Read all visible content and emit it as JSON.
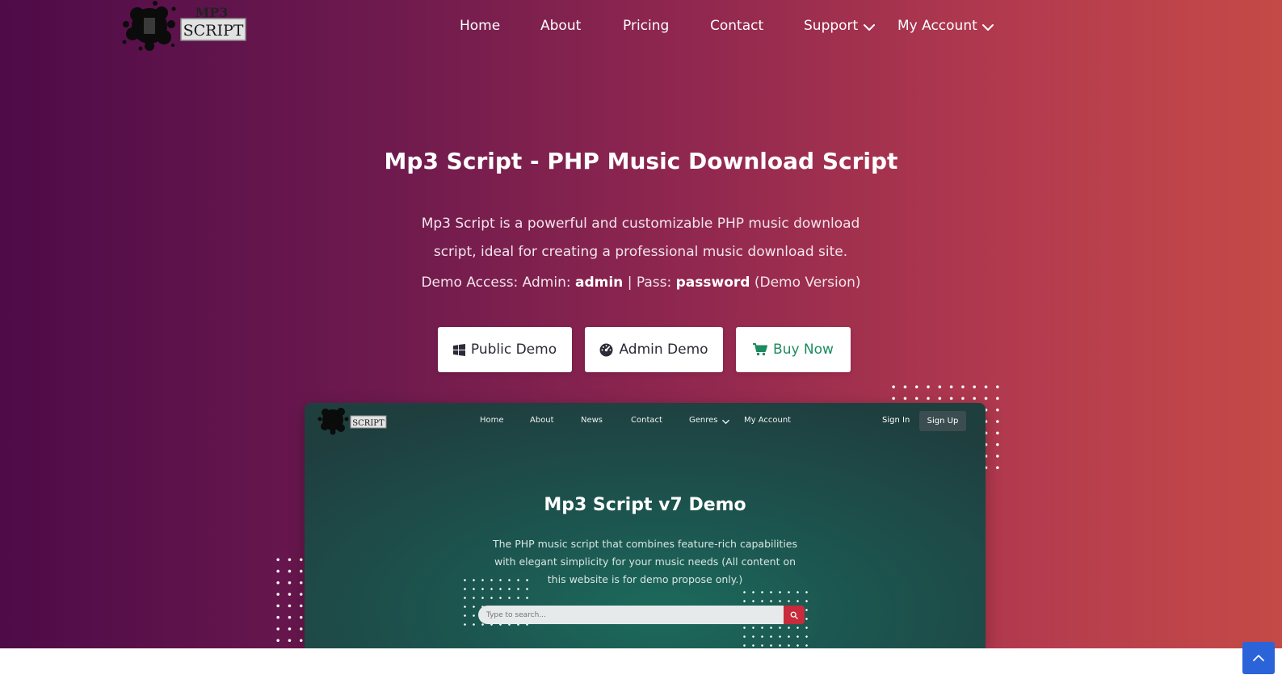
{
  "colors": {
    "hero_gradient_start": "#4e0b48",
    "hero_gradient_end": "#c44a47",
    "buy_button_text": "#1d8a5f",
    "preview_bg": "#1c5650",
    "preview_search_button": "#c72b3c",
    "back_to_top": "#2b64d8"
  },
  "logo": {
    "top_text": "MP3",
    "bottom_text": "SCRIPT"
  },
  "nav": {
    "items": [
      {
        "label": "Home"
      },
      {
        "label": "About"
      },
      {
        "label": "Pricing"
      },
      {
        "label": "Contact"
      },
      {
        "label": "Support",
        "dropdown": true
      },
      {
        "label": "My Account",
        "dropdown": true
      }
    ]
  },
  "hero": {
    "title": "Mp3 Script - PHP Music Download Script",
    "description": "Mp3 Script is a powerful and customizable PHP music download script, ideal for creating a professional music download site.",
    "access": {
      "prefix": "Demo Access: Admin:",
      "admin_user": "admin",
      "separator": "|",
      "pass_label": "Pass:",
      "admin_pass": "password",
      "suffix": "(Demo Version)"
    }
  },
  "buttons": {
    "public_demo": {
      "label": "Public Demo",
      "icon": "windows-icon"
    },
    "admin_demo": {
      "label": "Admin Demo",
      "icon": "dashboard-icon"
    },
    "buy_now": {
      "label": "Buy Now",
      "icon": "cart-icon"
    }
  },
  "preview": {
    "logo_text": "SCRIPT",
    "nav": [
      "Home",
      "About",
      "News",
      "Contact",
      "Genres",
      "My Account"
    ],
    "sign_in": "Sign In",
    "sign_up": "Sign Up",
    "title": "Mp3 Script v7 Demo",
    "description": "The PHP music script that combines feature-rich capabilities with elegant simplicity for your music needs (All content on this website is for demo propose only.)",
    "search_placeholder": "Type to search..."
  },
  "back_to_top_icon": "chevron-up-icon"
}
